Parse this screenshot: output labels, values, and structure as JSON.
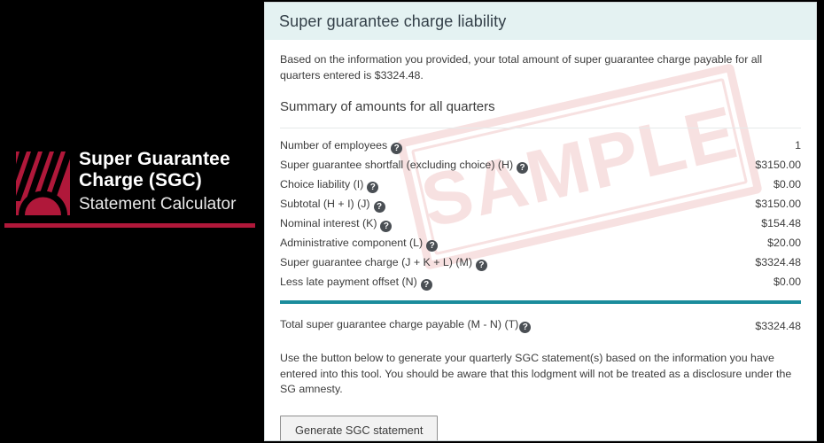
{
  "brand": {
    "line1": "Super Guarantee",
    "line2": "Charge (SGC)",
    "line3": "Statement Calculator",
    "logo_icon": "sunrise-stripes-logo-icon",
    "accent_color": "#b0183a"
  },
  "panel": {
    "title": "Super guarantee charge liability",
    "header_bg": "#e4f2f2",
    "intro_paragraph": "Based on the information you provided, your total amount of super guarantee charge payable for all quarters entered is $3324.48.",
    "summary_heading": "Summary of amounts for all quarters",
    "rule_color": "#1b8c9c",
    "help_icon": "help-circle-icon",
    "help_glyph": "?"
  },
  "summary_rows": [
    {
      "label": "Number of employees",
      "value": "1"
    },
    {
      "label": "Super guarantee shortfall (excluding choice) (H)",
      "value": "$3150.00"
    },
    {
      "label": "Choice liability (I)",
      "value": "$0.00"
    },
    {
      "label": "Subtotal (H + I) (J)",
      "value": "$3150.00"
    },
    {
      "label": "Nominal interest (K)",
      "value": "$154.48"
    },
    {
      "label": "Administrative component (L)",
      "value": "$20.00"
    },
    {
      "label": "Super guarantee charge (J + K + L) (M)",
      "value": "$3324.48"
    },
    {
      "label": "Less late payment offset (N)",
      "value": "$0.00"
    }
  ],
  "total": {
    "label": "Total super guarantee charge payable (M - N) (T)",
    "value": "$3324.48"
  },
  "outro_paragraph": "Use the button below to generate your quarterly SGC statement(s) based on the information you have entered into this tool. You should be aware that this lodgment will not be treated as a disclosure under the SG amnesty.",
  "generate_button_label": "Generate SGC statement",
  "watermark": {
    "text": "SAMPLE",
    "color": "#f2c9c9"
  }
}
